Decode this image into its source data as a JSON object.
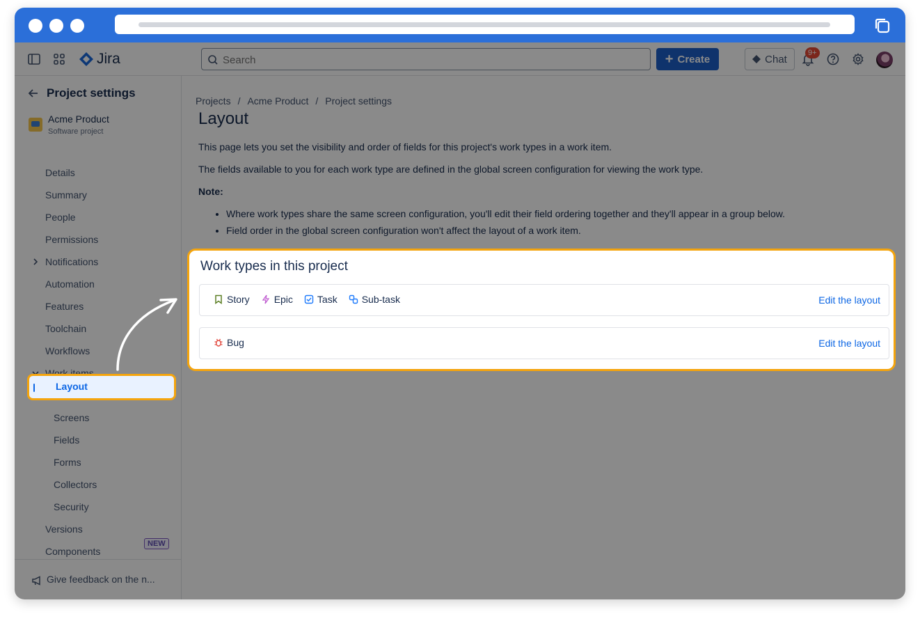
{
  "app": {
    "name": "Jira"
  },
  "topnav": {
    "search_placeholder": "Search",
    "create_label": "Create",
    "chat_label": "Chat",
    "notification_count": "9+"
  },
  "sidebar": {
    "header": "Project settings",
    "project_name": "Acme Product",
    "project_type": "Software project",
    "items": {
      "details": "Details",
      "summary": "Summary",
      "people": "People",
      "permissions": "Permissions",
      "notifications": "Notifications",
      "automation": "Automation",
      "features": "Features",
      "toolchain": "Toolchain",
      "workflows": "Workflows",
      "work_items": "Work items",
      "layout": "Layout",
      "screens": "Screens",
      "fields": "Fields",
      "forms": "Forms",
      "collectors": "Collectors",
      "security": "Security",
      "versions": "Versions",
      "components": "Components"
    },
    "new_badge": "NEW",
    "feedback": "Give feedback on the n..."
  },
  "main": {
    "breadcrumb": [
      "Projects",
      "/",
      "Acme Product",
      "/",
      "Project settings"
    ],
    "title": "Layout",
    "para1": "This page lets you set the visibility and order of fields for this project's work types in a work item.",
    "para2": "The fields available to you for each work type are defined in the global screen configuration for viewing the work type.",
    "note": "Note:",
    "bullets": [
      "Where work types share the same screen configuration, you'll edit their field ordering together and they'll appear in a group below.",
      "Field order in the global screen configuration won't affect the layout of a work item."
    ],
    "card": {
      "title": "Work types in this project",
      "group1": {
        "types": [
          "Story",
          "Epic",
          "Task",
          "Sub-task"
        ],
        "link": "Edit the layout"
      },
      "group2": {
        "types": [
          "Bug"
        ],
        "link": "Edit the layout"
      }
    }
  },
  "colors": {
    "accent": "#0c66e4",
    "highlight": "#f4a40d",
    "titlebar": "#2b6fd9"
  }
}
